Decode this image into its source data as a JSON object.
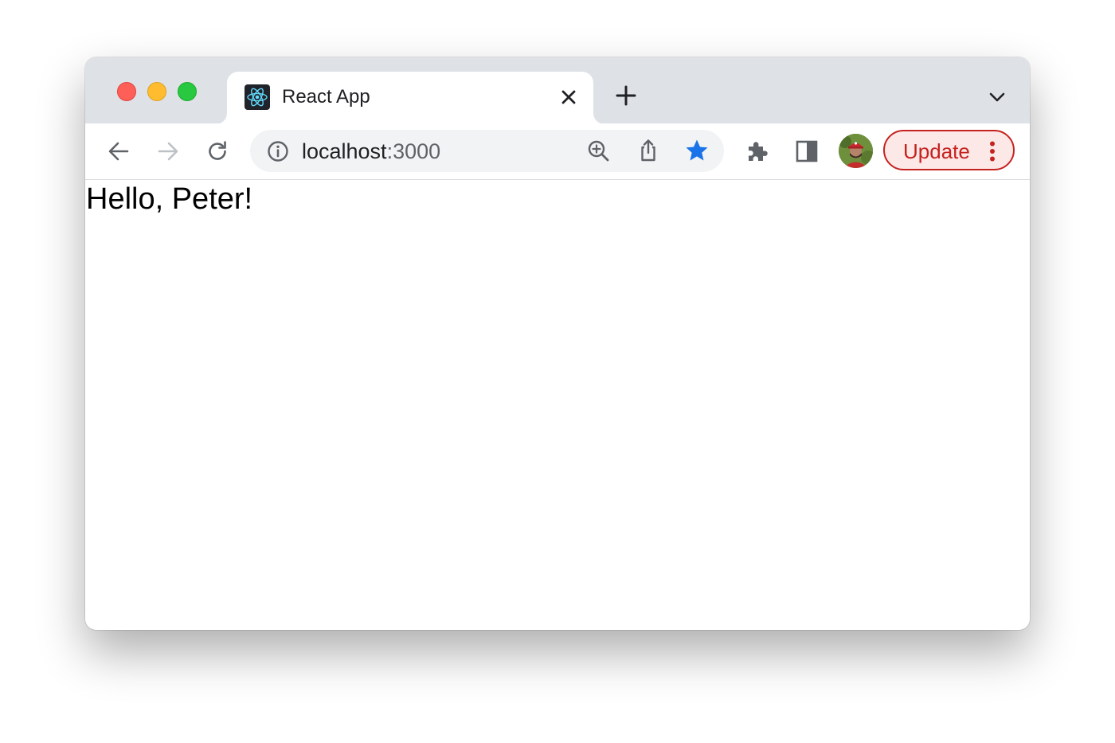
{
  "window": {
    "traffic_lights": [
      "close",
      "minimize",
      "zoom"
    ]
  },
  "tabs": [
    {
      "title": "React App",
      "favicon": "react-logo-icon",
      "active": true
    }
  ],
  "toolbar": {
    "address": {
      "host": "localhost",
      "port": ":3000"
    },
    "update_label": "Update",
    "icons": [
      "back-arrow-icon",
      "forward-arrow-icon",
      "reload-icon",
      "info-icon",
      "zoom-in-icon",
      "share-icon",
      "star-icon",
      "extensions-puzzle-icon",
      "side-panel-icon",
      "profile-avatar",
      "more-vert-icon"
    ]
  },
  "page": {
    "greeting": "Hello, Peter!"
  },
  "colors": {
    "accent_blue": "#1a73e8",
    "update_red": "#c5221f",
    "tab_strip": "#dee1e6",
    "omnibox": "#f1f3f4"
  }
}
